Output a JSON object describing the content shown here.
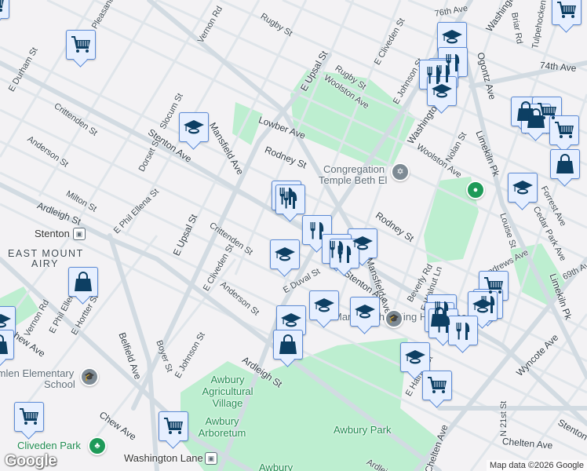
{
  "map": {
    "attribution": "Map data ©2026 Google",
    "logo": "Google",
    "colors": {
      "background": "#f3f2f4",
      "road": "#d6dee4",
      "park": "#bdeed0",
      "marker_bg": "#e6efff",
      "marker_border": "#5c8bd6",
      "icon": "#0d3f63",
      "park_text": "#1e8a4f"
    },
    "street_labels": [
      "Vernon Rd",
      "Rugby St",
      "E Durham St",
      "Pleasant",
      "Crittenden St",
      "Anderson St",
      "Slocum St",
      "Stenton Ave",
      "Mansfield Ave",
      "Lowber Ave",
      "Rodney St",
      "Dorset St",
      "Milton St",
      "Ardleigh St",
      "E Phil Ellena St",
      "E Upsal St",
      "Crittenden St",
      "E Upsal St",
      "Rugby St",
      "Woolston Ave",
      "E Cliveden St",
      "E Johnson St",
      "76th Ave",
      "Washington Ln",
      "Washington Ln",
      "Briar Rd",
      "Tulpehocken St",
      "Ogontz Ave",
      "74th Ave",
      "Woolston Ave",
      "Nolan St",
      "Limekiln Pk",
      "Rodney St",
      "Forrest Ave",
      "Cedar Park Ave",
      "Louise St",
      "E Duval St",
      "E Cliveden St",
      "Anderson St",
      "Vernon Rd",
      "E Phil Ellen",
      "E Hortter St",
      "Chew Ave",
      "Belfield Ave",
      "Boyer St",
      "E Johnson St",
      "Ardleigh St",
      "Chew Ave",
      "Beverly Rd",
      "E Walnut Ln",
      "Andrews Ave",
      "69th Ave",
      "Limekiln Pk",
      "Wyncote Ave",
      "E Haines St",
      "N 21st St",
      "Chelten Ave",
      "Stenton Ave",
      "Chelten Ave",
      "Ardleigh St",
      "Mansfield Ave",
      "Stenton Ave"
    ],
    "area_labels": {
      "neighborhood_1": "EAST MOUNT",
      "neighborhood_2": "AIRY"
    },
    "places": {
      "temple_1": "Congregation",
      "temple_2": "Temple Beth El",
      "stenton_station": "Stenton",
      "washington_lane_station": "Washington Lane",
      "school_1": "Emlen Elementary",
      "school_2": "School",
      "high_school": "Martin Luther King High School",
      "awbury_village_1": "Awbury",
      "awbury_village_2": "Agricultural",
      "awbury_village_3": "Village",
      "arboretum_1": "Awbury",
      "arboretum_2": "Arboretum",
      "cliveden_park": "Cliveden Park",
      "awbury_park": "Awbury Park",
      "awbury_bottom": "Awbury"
    },
    "marker_types": [
      "school-icon",
      "restaurant-icon",
      "grocery-cart-icon",
      "shopping-bag-icon"
    ]
  }
}
